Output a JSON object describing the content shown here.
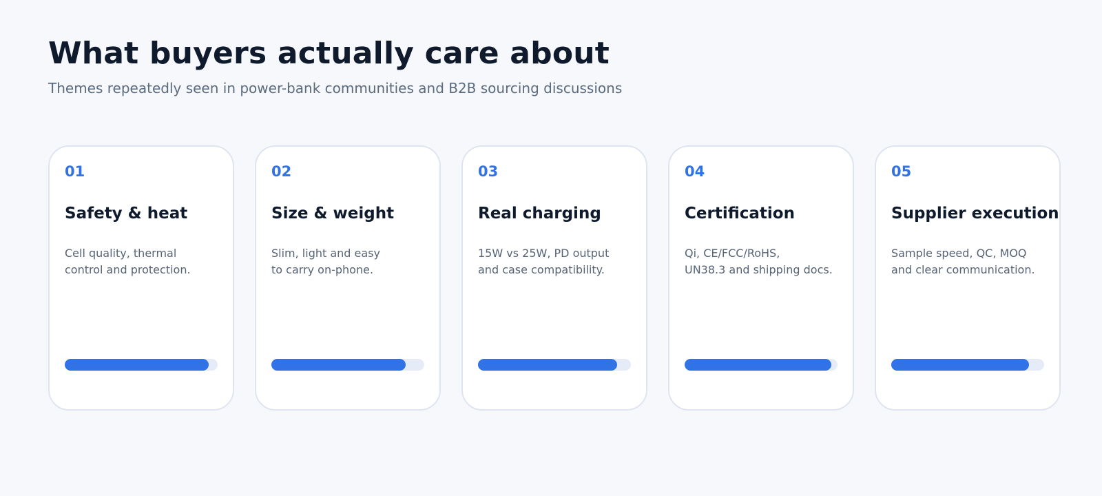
{
  "header": {
    "title": "What buyers actually care about",
    "subtitle": "Themes repeatedly seen in power-bank communities and B2B sourcing discussions"
  },
  "colors": {
    "accent": "#3173e6",
    "track": "#e6ecf7",
    "title": "#0f1b2d",
    "muted": "#566476",
    "background": "#f6f8fc"
  },
  "cards": [
    {
      "number": "01",
      "title": "Safety & heat",
      "desc_lines": [
        "Cell quality, thermal",
        "control and protection."
      ],
      "score": 0.94
    },
    {
      "number": "02",
      "title": "Size & weight",
      "desc_lines": [
        "Slim, light and easy",
        "to carry on-phone."
      ],
      "score": 0.88
    },
    {
      "number": "03",
      "title": "Real charging",
      "desc_lines": [
        "15W vs 25W, PD output",
        "and case compatibility."
      ],
      "score": 0.91
    },
    {
      "number": "04",
      "title": "Certification",
      "desc_lines": [
        "Qi, CE/FCC/RoHS,",
        "UN38.3 and shipping docs."
      ],
      "score": 0.96
    },
    {
      "number": "05",
      "title": "Supplier execution",
      "desc_lines": [
        "Sample speed, QC, MOQ",
        "and clear communication."
      ],
      "score": 0.9
    }
  ]
}
